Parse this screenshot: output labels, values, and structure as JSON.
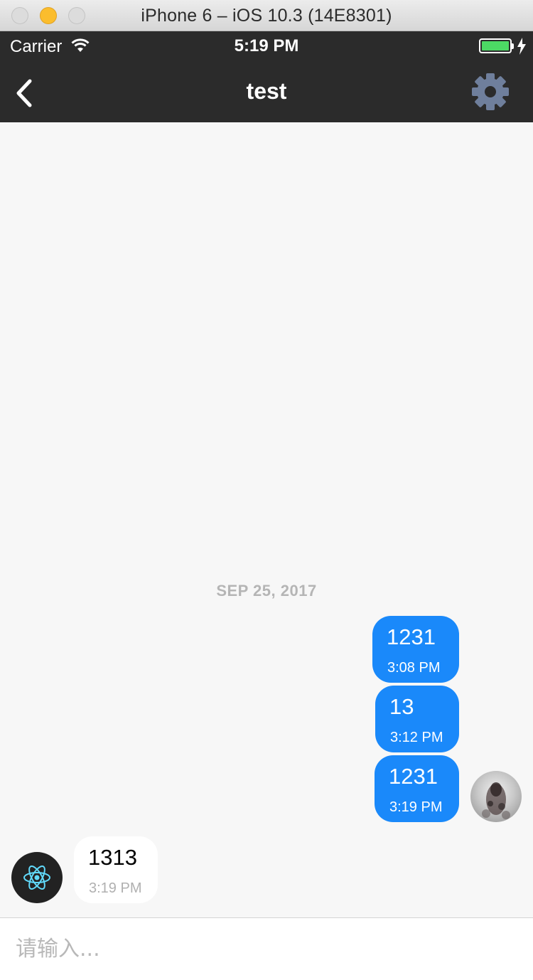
{
  "window": {
    "title": "iPhone 6 – iOS 10.3 (14E8301)"
  },
  "status_bar": {
    "carrier": "Carrier",
    "time": "5:19 PM",
    "battery_percent": 100
  },
  "nav": {
    "title": "test",
    "back_icon": "chevron-left-icon",
    "settings_icon": "gear-icon"
  },
  "chat": {
    "date_separator": "SEP 25, 2017",
    "messages": [
      {
        "text": "1231",
        "time": "3:08 PM",
        "direction": "outgoing"
      },
      {
        "text": "13",
        "time": "3:12 PM",
        "direction": "outgoing"
      },
      {
        "text": "1231",
        "time": "3:19 PM",
        "direction": "outgoing"
      },
      {
        "text": "1313",
        "time": "3:19 PM",
        "direction": "incoming"
      }
    ]
  },
  "input": {
    "placeholder": "请输入...",
    "value": ""
  },
  "colors": {
    "nav_background": "#2b2b2b",
    "outgoing_bubble": "#1a89fa",
    "incoming_bubble": "#ffffff",
    "chat_background": "#f7f7f7",
    "battery": "#4cd964",
    "gear": "#6f7f9c",
    "react_logo": "#61dafb"
  }
}
